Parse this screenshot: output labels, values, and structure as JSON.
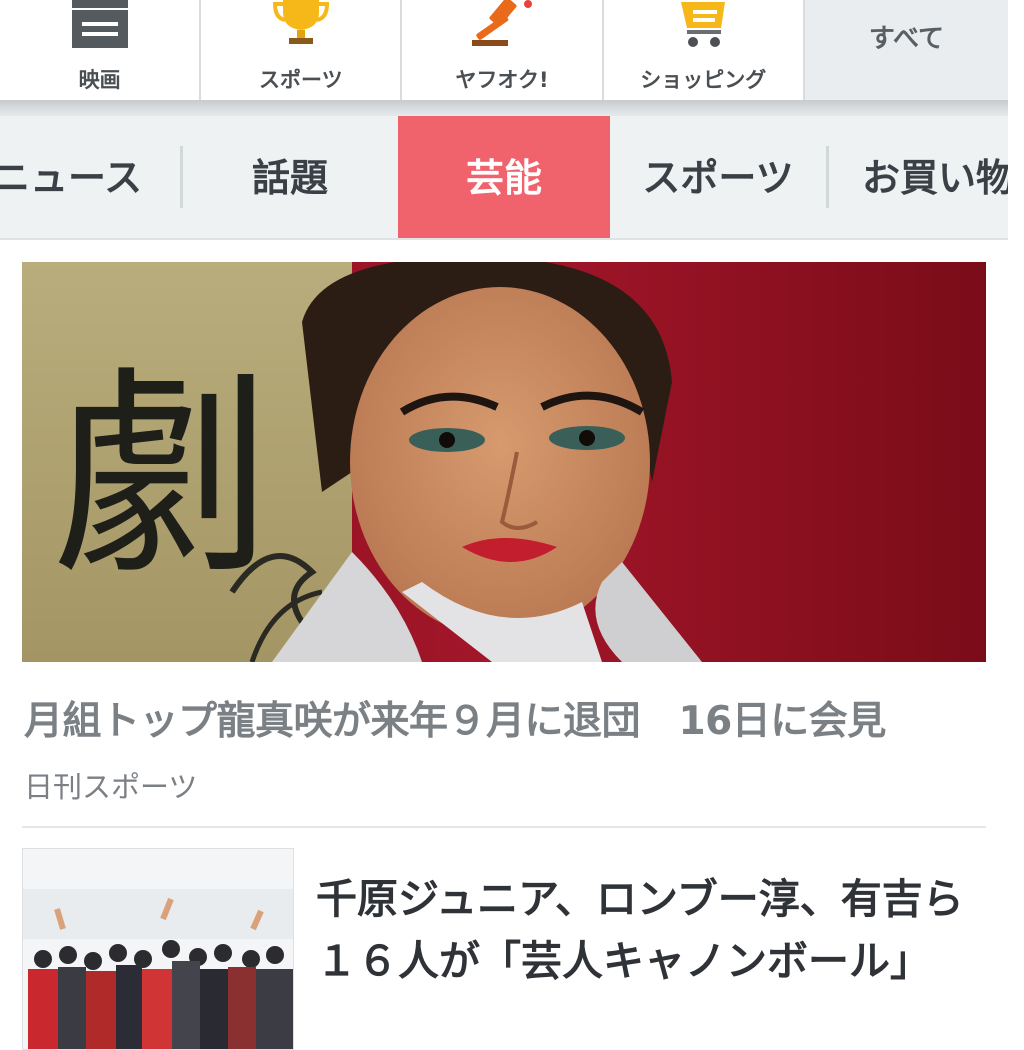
{
  "services": {
    "items": [
      {
        "label": "映画",
        "icon": "clapperboard-icon"
      },
      {
        "label": "スポーツ",
        "icon": "trophy-icon"
      },
      {
        "label": "ヤフオク!",
        "icon": "gavel-icon"
      },
      {
        "label": "ショッピング",
        "icon": "cart-icon"
      }
    ],
    "all_label": "すべて"
  },
  "tabs": {
    "items": [
      "ニュース",
      "話題",
      "芸能",
      "スポーツ",
      "お買い物"
    ],
    "active": "芸能",
    "active_color": "#f0636c"
  },
  "hero": {
    "image_sign_text": "劇",
    "title": "月組トップ龍真咲が来年９月に退団　16日に会見",
    "source": "日刊スポーツ"
  },
  "article2": {
    "title": "千原ジュニア、ロンブー淳、有吉ら１６人が「芸人キャノンボール」"
  }
}
